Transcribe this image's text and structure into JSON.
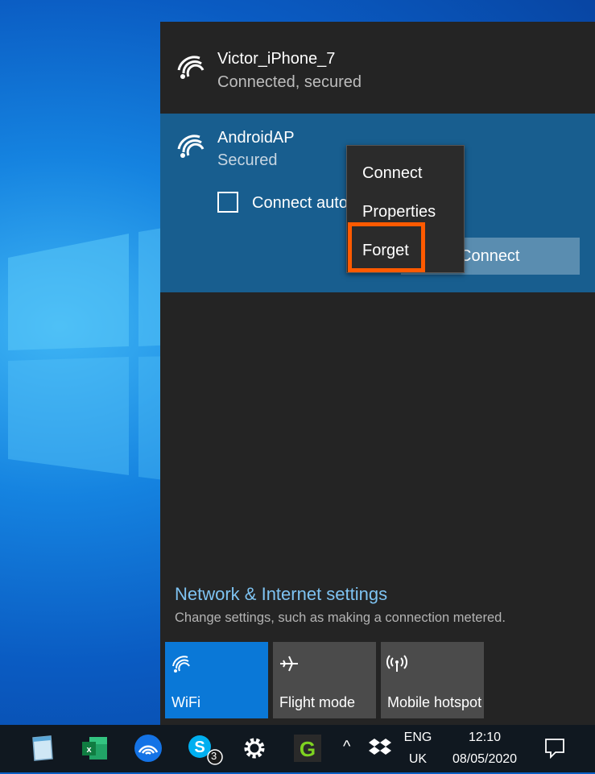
{
  "networks": [
    {
      "name": "Victor_iPhone_7",
      "status": "Connected, secured"
    },
    {
      "name": "AndroidAP",
      "status": "Secured",
      "auto_connect_label": "Connect automatically",
      "connect_label": "Connect"
    }
  ],
  "context_menu": {
    "items": [
      "Connect",
      "Properties",
      "Forget"
    ],
    "highlighted": "Forget",
    "highlight_color": "#ff5a00"
  },
  "settings": {
    "link": "Network & Internet settings",
    "description": "Change settings, such as making a connection metered."
  },
  "quick_actions": [
    {
      "label": "WiFi",
      "icon": "wifi-icon",
      "active": true
    },
    {
      "label": "Flight mode",
      "icon": "airplane-icon",
      "active": false
    },
    {
      "label": "Mobile hotspot",
      "icon": "hotspot-icon",
      "active": false
    }
  ],
  "taskbar": {
    "apps": [
      "notepad-icon",
      "excel-icon",
      "network-app-icon",
      "skype-icon",
      "settings-gear-icon",
      "greenshot-icon"
    ],
    "skype_badge": "3",
    "language": "ENG",
    "region": "UK",
    "time": "12:10",
    "date": "08/05/2020"
  },
  "colors": {
    "accent": "#0a78d7",
    "selected_network_bg": "#185e8f",
    "link": "#7ec3f2"
  }
}
